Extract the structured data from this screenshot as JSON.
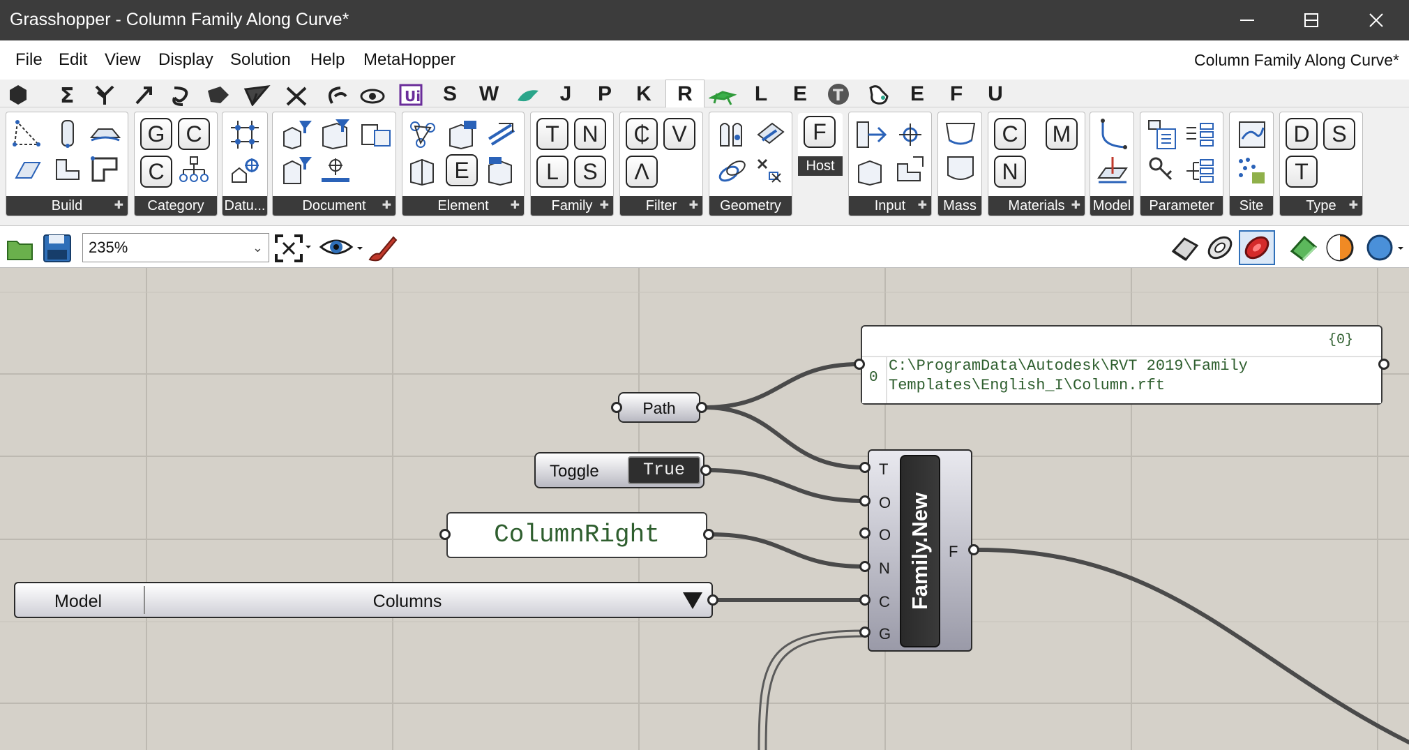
{
  "window": {
    "title": "Grasshopper - Column Family Along Curve*"
  },
  "menu": {
    "items": [
      "File",
      "Edit",
      "View",
      "Display",
      "Solution",
      "Help",
      "MetaHopper"
    ],
    "document_name": "Column Family Along Curve*"
  },
  "tabs": {
    "letters": [
      "S",
      "W",
      "J",
      "P",
      "K",
      "R",
      "L",
      "E",
      "E",
      "F",
      "U"
    ],
    "active": "R"
  },
  "ribbon": {
    "panels": [
      "Build",
      "Category",
      "Datu...",
      "Document",
      "Element",
      "Family",
      "Filter",
      "Geometry",
      "Input",
      "Mass",
      "Materials",
      "Model",
      "Parameter",
      "Site",
      "Type"
    ],
    "host_label": "Host",
    "host_letter": "F",
    "category_letters": [
      "G",
      "C",
      "C"
    ],
    "element_letters": [
      "E"
    ],
    "family_letters": [
      "T",
      "N",
      "L",
      "S"
    ],
    "filter_letters": [
      "₵",
      "V",
      "Λ"
    ],
    "materials_letters": [
      "C",
      "M",
      "N"
    ],
    "type_letters": [
      "D",
      "S",
      "T"
    ]
  },
  "toolbar": {
    "zoom": "235%"
  },
  "canvas": {
    "path_label": "Path",
    "toggle_label": "Toggle",
    "toggle_value": "True",
    "text_panel_value": "ColumnRight",
    "value_list_label": "Model",
    "value_list_value": "Columns",
    "file_panel": {
      "branch": "{0}",
      "index": "0",
      "line1": "C:\\ProgramData\\Autodesk\\RVT 2019\\Family",
      "line2": "Templates\\English_I\\Column.rft"
    },
    "family_node": {
      "title": "Family.New",
      "inputs": [
        "T",
        "O",
        "O",
        "N",
        "C",
        "G"
      ],
      "output": "F"
    }
  },
  "colors": {
    "titlebar": "#3c3c3c",
    "canvas": "#d5d1c9",
    "wire": "#4a4a4a",
    "panel_text": "#2e5e2e"
  }
}
